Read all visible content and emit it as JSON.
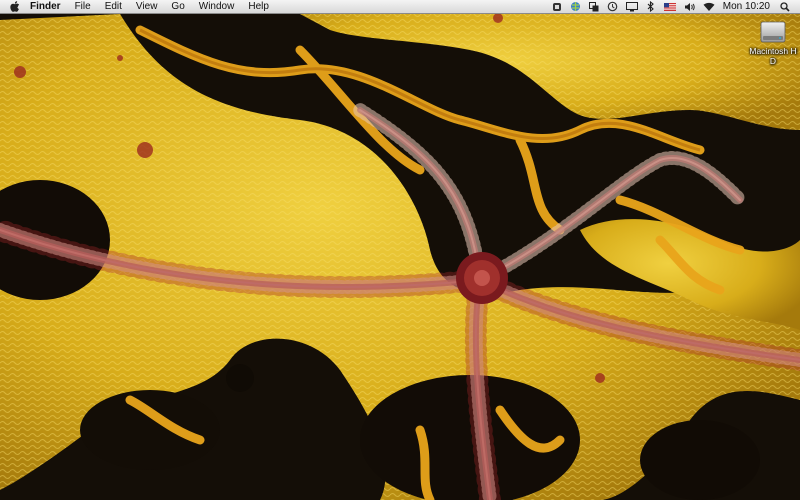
{
  "menubar": {
    "app_name": "Finder",
    "menus": [
      "File",
      "Edit",
      "View",
      "Go",
      "Window",
      "Help"
    ],
    "status_icons": [
      "evernote-icon",
      "network-globe-icon",
      "spaces-icon",
      "time-machine-icon",
      "display-icon",
      "bluetooth-icon",
      "input-flag-us-icon",
      "volume-icon",
      "wifi-icon"
    ],
    "clock": "Mon 10:20"
  },
  "desktop": {
    "icons": [
      {
        "label": "Macintosh HD",
        "icon": "hard-drive-icon"
      }
    ]
  },
  "colors": {
    "menubar_top": "#f4f4f4",
    "menubar_bottom": "#d9d9d9",
    "sponge_yellow": "#d9b21c",
    "sponge_dark": "#120d06",
    "vein_orange": "#e8a21a",
    "star_red": "#8c1f22"
  }
}
